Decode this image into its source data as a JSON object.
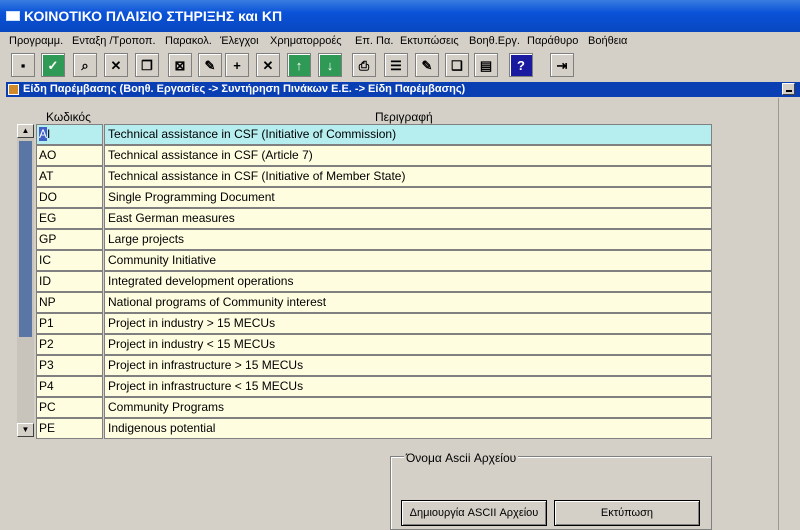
{
  "window": {
    "title": "ΚΟΙΝΟΤΙΚΟ ΠΛΑΙΣΙΟ ΣΤΗΡΙΞΗΣ και ΚΠ"
  },
  "menu": [
    "Προγραμμ.",
    "Ενταξη /Τροποπ.",
    "Παρακολ.",
    "Έλεγχοι",
    "Χρηματορροές",
    "Επ. Πα.",
    "Εκτυπώσεις",
    "Βοηθ.Εργ.",
    "Παράθυρο",
    "Βοήθεια"
  ],
  "toolbar": [
    {
      "name": "save-disk-icon",
      "glyph": "▪"
    },
    {
      "name": "check-icon",
      "glyph": "✓"
    },
    {
      "name": "find-icon",
      "glyph": "⌕"
    },
    {
      "name": "clear-icon",
      "glyph": "✕"
    },
    {
      "name": "copy-icon",
      "glyph": "❐"
    },
    {
      "name": "query-icon",
      "glyph": "⊠"
    },
    {
      "name": "edit-pencil-icon",
      "glyph": "✎"
    },
    {
      "name": "add-record-icon",
      "glyph": "+"
    },
    {
      "name": "delete-record-icon",
      "glyph": "✕"
    },
    {
      "name": "arrow-up-icon",
      "glyph": "↑"
    },
    {
      "name": "arrow-down-icon",
      "glyph": "↓"
    },
    {
      "name": "print-icon",
      "glyph": "⎙"
    },
    {
      "name": "list-icon",
      "glyph": "☰"
    },
    {
      "name": "edit-note-icon",
      "glyph": "✎"
    },
    {
      "name": "document-icon",
      "glyph": "❏"
    },
    {
      "name": "clipboard-icon",
      "glyph": "▤"
    },
    {
      "name": "help-icon",
      "glyph": "?"
    },
    {
      "name": "exit-door-icon",
      "glyph": "⇥"
    }
  ],
  "child_window": {
    "title": "Είδη Παρέμβασης (Βοηθ. Εργασίες -> Συντήρηση Πινάκων Ε.Ε. -> Είδη Παρέμβασης)"
  },
  "table": {
    "headers": {
      "code": "Κωδικός",
      "description": "Περιγραφή"
    },
    "rows": [
      {
        "code": "AI",
        "description": "Technical assistance in CSF (Initiative of Commission)"
      },
      {
        "code": "AO",
        "description": "Technical assistance in CSF (Article 7)"
      },
      {
        "code": "AT",
        "description": "Technical assistance in CSF (Initiative of Member State)"
      },
      {
        "code": "DO",
        "description": "Single Programming Document"
      },
      {
        "code": "EG",
        "description": "East German measures"
      },
      {
        "code": "GP",
        "description": "Large projects"
      },
      {
        "code": "IC",
        "description": "Community Initiative"
      },
      {
        "code": "ID",
        "description": "Integrated development operations"
      },
      {
        "code": "NP",
        "description": "National programs of Community interest"
      },
      {
        "code": "P1",
        "description": "Project in industry > 15 MECUs"
      },
      {
        "code": "P2",
        "description": "Project in industry < 15 MECUs"
      },
      {
        "code": "P3",
        "description": "Project in infrastructure > 15 MECUs"
      },
      {
        "code": "P4",
        "description": "Project in infrastructure < 15 MECUs"
      },
      {
        "code": "PC",
        "description": "Community Programs"
      },
      {
        "code": "PE",
        "description": "Indigenous potential"
      }
    ]
  },
  "ascii_group": {
    "label": "Όνομα Ascii Αρχείου",
    "create_button": "Δημιουργία ASCII Αρχείου",
    "print_button": "Εκτύπωση"
  }
}
